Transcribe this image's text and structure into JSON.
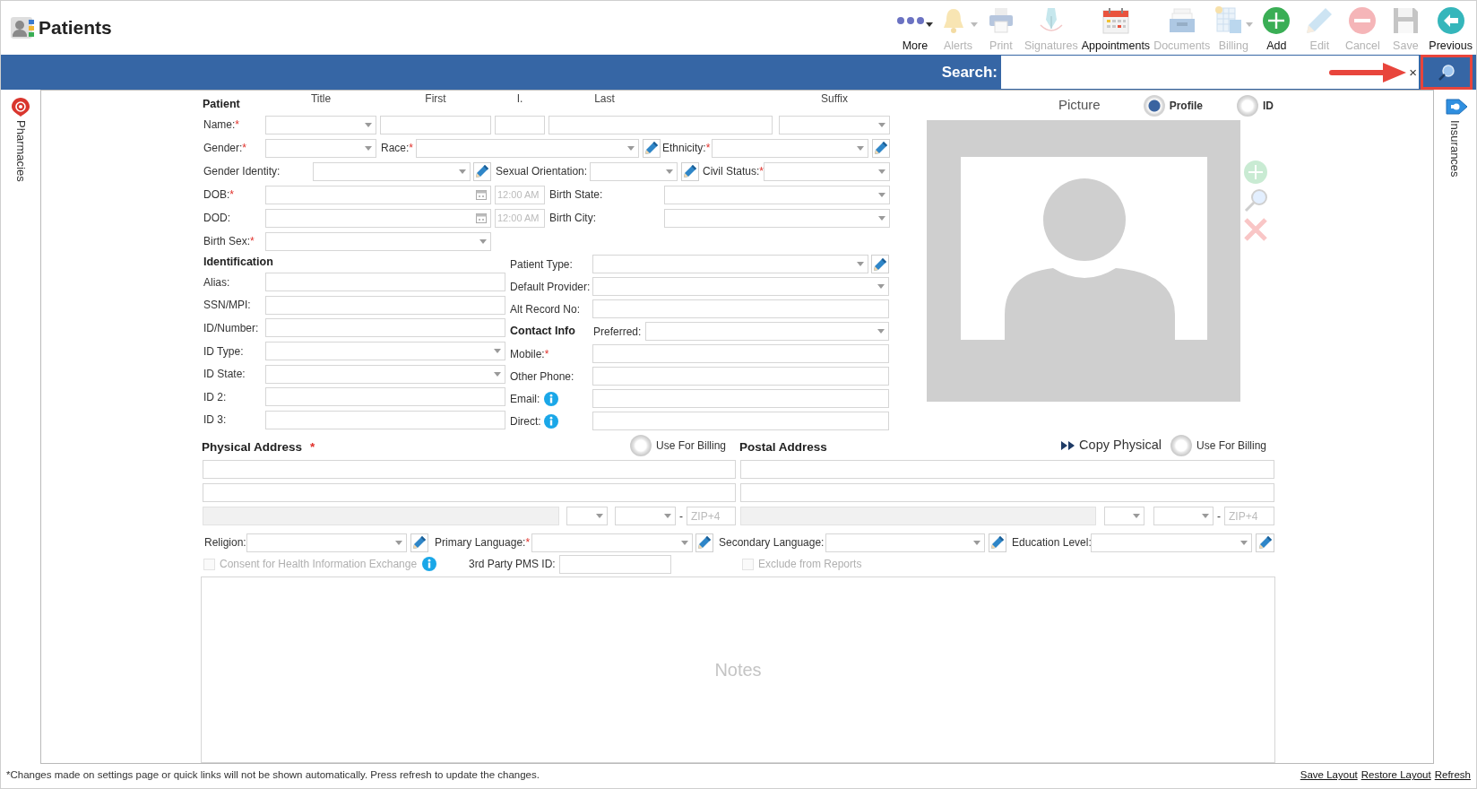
{
  "header": {
    "title": "Patients"
  },
  "toolbar": [
    {
      "kind": "dots",
      "label": "More",
      "disabled": false,
      "dropdown": true
    },
    {
      "kind": "bell",
      "label": "Alerts",
      "disabled": true,
      "dropdown": true
    },
    {
      "kind": "printer",
      "label": "Print",
      "disabled": true,
      "dropdown": false
    },
    {
      "kind": "nib",
      "label": "Signatures",
      "disabled": true,
      "dropdown": false
    },
    {
      "kind": "calendar",
      "label": "Appointments",
      "disabled": false,
      "dropdown": false
    },
    {
      "kind": "tray",
      "label": "Documents",
      "disabled": true,
      "dropdown": false
    },
    {
      "kind": "sheet",
      "label": "Billing",
      "disabled": true,
      "dropdown": true
    },
    {
      "kind": "plus",
      "label": "Add",
      "disabled": false,
      "dropdown": false
    },
    {
      "kind": "pencil",
      "label": "Edit",
      "disabled": true,
      "dropdown": false
    },
    {
      "kind": "minus",
      "label": "Cancel",
      "disabled": true,
      "dropdown": false
    },
    {
      "kind": "floppy",
      "label": "Save",
      "disabled": true,
      "dropdown": false
    },
    {
      "kind": "back",
      "label": "Previous",
      "disabled": false,
      "dropdown": false
    }
  ],
  "search": {
    "label": "Search:",
    "clear": "×"
  },
  "left_tab": {
    "label": "Pharmacies"
  },
  "right_tab": {
    "label": "Insurances"
  },
  "patient": {
    "heading": "Patient",
    "columns": [
      "Title",
      "First",
      "I.",
      "Last",
      "Suffix"
    ],
    "rows": [
      [
        {
          "kind": "label",
          "text": "Name:",
          "mark": "*"
        },
        {
          "kind": "select"
        },
        {
          "kind": "input"
        },
        {
          "kind": "input"
        },
        {
          "kind": "input"
        },
        {
          "kind": "select"
        }
      ],
      [
        {
          "kind": "label",
          "text": "Gender:",
          "mark": "*"
        },
        {
          "kind": "select"
        },
        {
          "kind": "label",
          "text": "Race:",
          "mark": "*"
        },
        {
          "kind": "select"
        },
        {
          "kind": "edit"
        },
        {
          "kind": "label",
          "text": "Ethnicity:",
          "mark": "*"
        },
        {
          "kind": "select"
        },
        {
          "kind": "edit"
        }
      ],
      [
        {
          "kind": "label",
          "text": "Gender Identity:"
        },
        {
          "kind": "select"
        },
        {
          "kind": "edit"
        },
        {
          "kind": "label",
          "text": "Sexual Orientation:"
        },
        {
          "kind": "select"
        },
        {
          "kind": "edit"
        },
        {
          "kind": "label",
          "text": "Civil Status:",
          "mark": "*"
        },
        {
          "kind": "select"
        }
      ],
      [
        {
          "kind": "label",
          "text": "DOB:",
          "mark": "*"
        },
        {
          "kind": "date"
        },
        {
          "kind": "time",
          "placeholder": "12:00 AM"
        },
        {
          "kind": "label",
          "text": "Birth State:"
        },
        {
          "kind": "select"
        }
      ],
      [
        {
          "kind": "label",
          "text": "DOD:"
        },
        {
          "kind": "date"
        },
        {
          "kind": "time",
          "placeholder": "12:00 AM"
        },
        {
          "kind": "label",
          "text": "Birth City:"
        },
        {
          "kind": "select"
        }
      ],
      [
        {
          "kind": "label",
          "text": "Birth Sex:",
          "mark": "*"
        },
        {
          "kind": "select"
        }
      ]
    ]
  },
  "identification": {
    "heading": "Identification",
    "rows": [
      [
        {
          "kind": "label",
          "text": "Alias:"
        },
        {
          "kind": "input"
        }
      ],
      [
        {
          "kind": "label",
          "text": "SSN/MPI:"
        },
        {
          "kind": "input"
        }
      ],
      [
        {
          "kind": "label",
          "text": "ID/Number:"
        },
        {
          "kind": "input"
        }
      ],
      [
        {
          "kind": "label",
          "text": "ID Type:"
        },
        {
          "kind": "select"
        }
      ],
      [
        {
          "kind": "label",
          "text": "ID State:"
        },
        {
          "kind": "select"
        }
      ],
      [
        {
          "kind": "label",
          "text": "ID 2:"
        },
        {
          "kind": "input"
        }
      ],
      [
        {
          "kind": "label",
          "text": "ID 3:"
        },
        {
          "kind": "input"
        }
      ]
    ]
  },
  "details": {
    "rows": [
      [
        {
          "kind": "label",
          "text": "Patient Type:"
        },
        {
          "kind": "select"
        },
        {
          "kind": "edit"
        }
      ],
      [
        {
          "kind": "label",
          "text": "Default Provider:"
        },
        {
          "kind": "select"
        }
      ],
      [
        {
          "kind": "label",
          "text": "Alt Record No:"
        },
        {
          "kind": "input"
        }
      ],
      [
        {
          "kind": "heading",
          "text": "Contact Info"
        },
        {
          "kind": "label",
          "text": "Preferred:"
        },
        {
          "kind": "select"
        }
      ],
      [
        {
          "kind": "label",
          "text": "Mobile:",
          "mark": "*"
        },
        {
          "kind": "input"
        }
      ],
      [
        {
          "kind": "label",
          "text": "Other Phone:"
        },
        {
          "kind": "input"
        }
      ],
      [
        {
          "kind": "label",
          "text": "Email:"
        },
        {
          "kind": "info"
        },
        {
          "kind": "input"
        }
      ],
      [
        {
          "kind": "label",
          "text": "Direct:"
        },
        {
          "kind": "info"
        },
        {
          "kind": "input"
        }
      ]
    ]
  },
  "picture": {
    "title": "Picture",
    "options": [
      {
        "label": "Profile",
        "selected": true
      },
      {
        "label": "ID",
        "selected": false
      }
    ]
  },
  "physical_address": {
    "heading": "Physical Address",
    "mark": "*",
    "billing": {
      "label": "Use For Billing",
      "selected": false
    },
    "lines": [
      [
        {
          "kind": "input",
          "disabled": false
        }
      ],
      [
        {
          "kind": "input",
          "disabled": false
        }
      ],
      [
        {
          "kind": "input",
          "disabled": true
        },
        {
          "kind": "select",
          "disabled": false
        },
        {
          "kind": "select",
          "disabled": false
        },
        {
          "kind": "sep",
          "text": "-",
          "disabled": false
        },
        {
          "kind": "input",
          "placeholder": "ZIP+4",
          "disabled": false
        }
      ]
    ]
  },
  "postal_address": {
    "heading": "Postal Address",
    "copy": "Copy Physical",
    "billing": {
      "label": "Use For Billing",
      "selected": false
    },
    "lines": [
      [
        {
          "kind": "input",
          "disabled": false
        }
      ],
      [
        {
          "kind": "input",
          "disabled": false
        }
      ],
      [
        {
          "kind": "input",
          "disabled": true
        },
        {
          "kind": "select",
          "disabled": false
        },
        {
          "kind": "select",
          "disabled": false
        },
        {
          "kind": "sep",
          "text": "-",
          "disabled": false
        },
        {
          "kind": "input",
          "placeholder": "ZIP+4",
          "disabled": false
        }
      ]
    ]
  },
  "other": {
    "row": [
      {
        "kind": "label",
        "text": "Religion:"
      },
      {
        "kind": "select"
      },
      {
        "kind": "edit"
      },
      {
        "kind": "label",
        "text": "Primary Language:",
        "mark": "*"
      },
      {
        "kind": "select"
      },
      {
        "kind": "edit"
      },
      {
        "kind": "label",
        "text": "Secondary Language:"
      },
      {
        "kind": "select"
      },
      {
        "kind": "edit"
      },
      {
        "kind": "label",
        "text": "Education Level:"
      },
      {
        "kind": "select"
      },
      {
        "kind": "edit"
      }
    ]
  },
  "consent": {
    "label": "Consent for Health Information Exchange",
    "checked": false,
    "disabled": true
  },
  "pms": {
    "label": "3rd Party PMS ID:"
  },
  "exclude": {
    "label": "Exclude from Reports",
    "checked": false,
    "disabled": true
  },
  "notes": {
    "placeholder": "Notes"
  },
  "footer": {
    "note": "*Changes made on settings page or quick links will not be shown automatically. Press refresh to update the changes.",
    "links": [
      "Save Layout",
      "Restore Layout",
      "Refresh"
    ]
  }
}
